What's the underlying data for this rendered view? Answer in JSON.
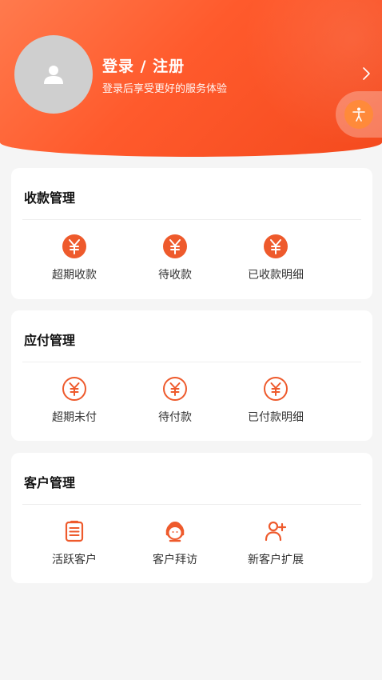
{
  "header": {
    "login_title": "登录 / 注册",
    "login_subtitle": "登录后享受更好的服务体验",
    "avatar_icon": "user-silhouette-icon",
    "arrow_icon": "chevron-right-icon",
    "float_icon": "accessibility-icon"
  },
  "colors": {
    "brand": "#ff5a2c",
    "icon_accent": "#ee5a2c",
    "avatar_bg": "#cfcfcf"
  },
  "sections": [
    {
      "title": "收款管理",
      "items": [
        {
          "label": "超期收款",
          "icon": "yuan-filled-icon"
        },
        {
          "label": "待收款",
          "icon": "yuan-filled-icon"
        },
        {
          "label": "已收款明细",
          "icon": "yuan-filled-icon"
        }
      ]
    },
    {
      "title": "应付管理",
      "items": [
        {
          "label": "超期未付",
          "icon": "yuan-outline-icon"
        },
        {
          "label": "待付款",
          "icon": "yuan-outline-icon"
        },
        {
          "label": "已付款明细",
          "icon": "yuan-outline-icon"
        }
      ]
    },
    {
      "title": "客户管理",
      "items": [
        {
          "label": "活跃客户",
          "icon": "clipboard-list-icon"
        },
        {
          "label": "客户拜访",
          "icon": "customer-service-icon"
        },
        {
          "label": "新客户扩展",
          "icon": "add-user-icon"
        }
      ]
    }
  ]
}
